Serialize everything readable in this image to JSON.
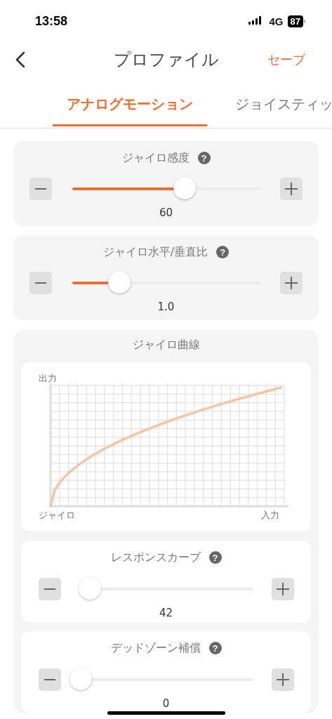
{
  "status_bar": {
    "time": "13:58",
    "network": "4G",
    "battery": "87"
  },
  "nav": {
    "title": "プロファイル",
    "action": "セーブ"
  },
  "tabs": [
    {
      "label": "アナログモーション",
      "selected": true
    },
    {
      "label": "ジョイスティッ",
      "selected": false
    }
  ],
  "settings": [
    {
      "label": "ジャイロ感度",
      "help": "?",
      "level": 0.6,
      "value": "60"
    },
    {
      "label": "ジャイロ水平/垂直比",
      "help": "?",
      "level": 0.25,
      "value": "1.0"
    }
  ],
  "gyro_curve": {
    "title": "ジャイロ曲線",
    "y_axis_label": "出力",
    "origin_label": "ジャイロ",
    "x_axis_label": "入力",
    "settings": [
      {
        "label": "レスポンスカーブ",
        "help": "?",
        "level": 0.06,
        "value": "42"
      },
      {
        "label": "デッドゾーン補償",
        "help": "?",
        "level": 0.01,
        "value": "0"
      }
    ]
  }
}
